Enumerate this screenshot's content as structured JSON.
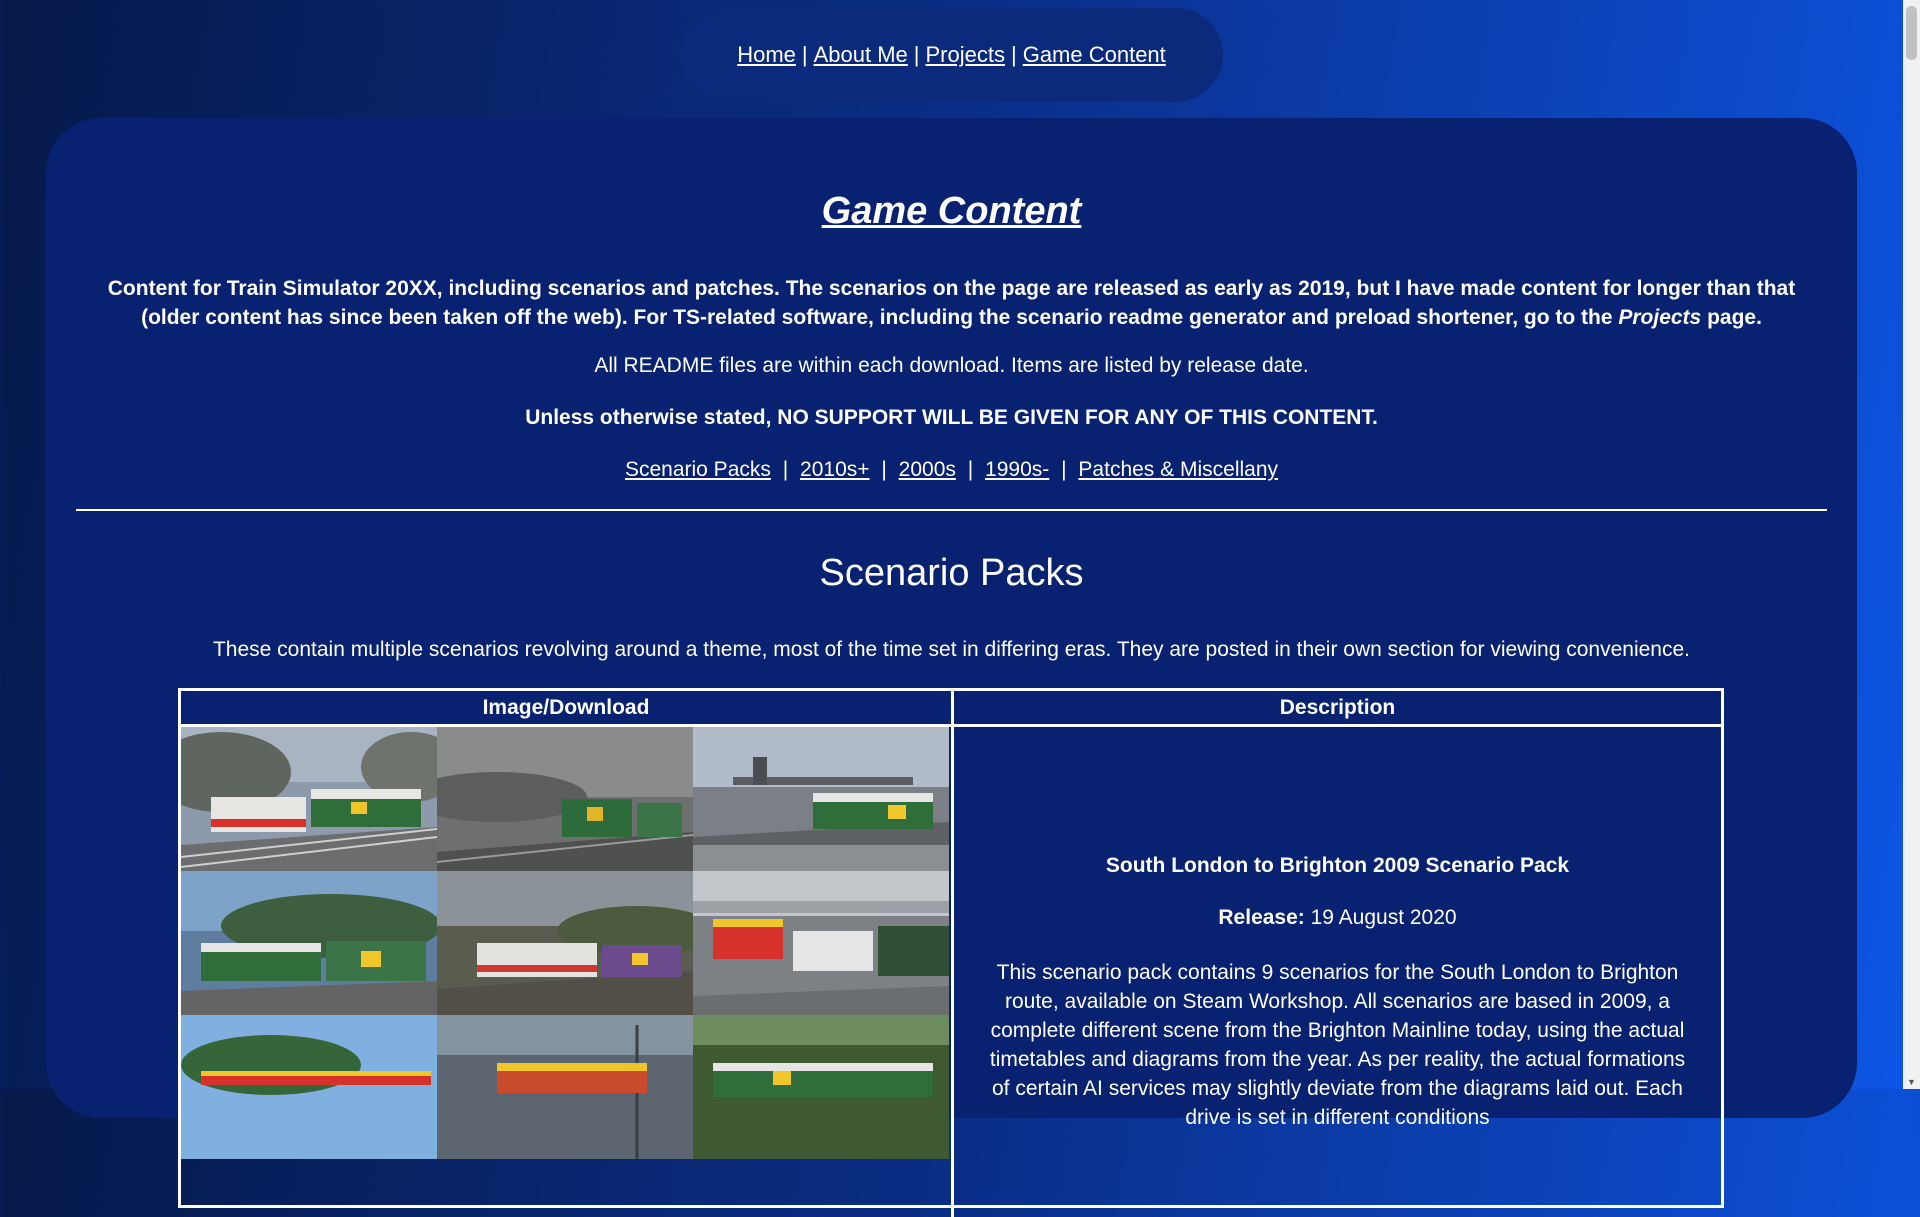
{
  "nav": {
    "items": [
      "Home",
      "About Me",
      "Projects",
      "Game Content"
    ],
    "separator": "|"
  },
  "page": {
    "title": "Game Content",
    "intro_before": "Content for Train Simulator 20XX, including scenarios and patches. The scenarios on the page are released as early as 2019, but I have made content for longer than that (older content has since been taken off the web). For TS-related software, including the scenario readme generator and preload shortener, go to the ",
    "intro_em": "Projects",
    "intro_after": " page.",
    "readme_note": "All README files are within each download. Items are listed by release date.",
    "warning": "Unless otherwise stated, NO SUPPORT WILL BE GIVEN FOR ANY OF THIS CONTENT."
  },
  "section_nav": {
    "items": [
      "Scenario Packs",
      "2010s+",
      "2000s",
      "1990s-",
      "Patches & Miscellany"
    ]
  },
  "section": {
    "heading": "Scenario Packs",
    "description": "These contain multiple scenarios revolving around a theme, most of the time set in differing eras. They are posted in their own section for viewing convenience."
  },
  "table": {
    "headers": [
      "Image/Download",
      "Description"
    ],
    "rows": [
      {
        "title": "South London to Brighton 2009 Scenario Pack",
        "release_label": "Release:",
        "release_date": " 19 August 2020",
        "description": "This scenario pack contains 9 scenarios for the South London to Brighton route, available on Steam Workshop. All scenarios are based in 2009, a complete different scene from the Brighton Mainline today, using the actual timetables and diagrams from the year. As per reality, the actual formations of certain AI services may slightly deviate from the diagrams laid out. Each drive is set in different conditions"
      }
    ]
  },
  "colors": {
    "background_start": "#06194a",
    "background_end": "#0d56e6",
    "panel": "#082271",
    "nav_pill": "#0b2a7c",
    "text": "#ffffff"
  }
}
